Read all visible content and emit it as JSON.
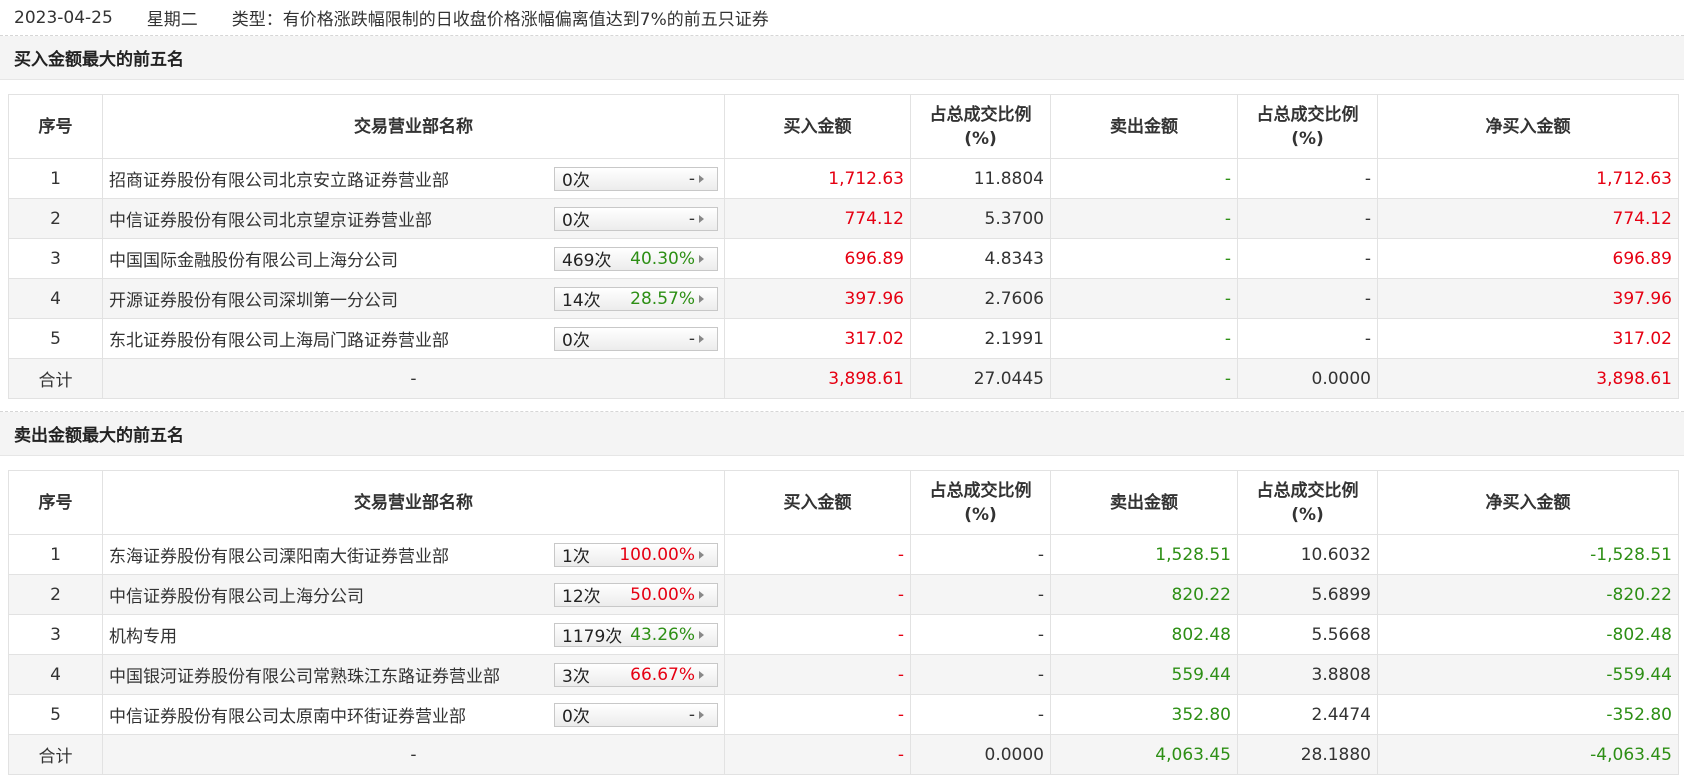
{
  "header": {
    "date": "2023-04-25",
    "weekday": "星期二",
    "type_text": "类型：有价格涨跌幅限制的日收盘价格涨幅偏离值达到7%的前五只证券"
  },
  "columns": {
    "idx": "序号",
    "name": "交易营业部名称",
    "buy": "买入金额",
    "ratio1_l1": "占总成交比例",
    "ratio1_l2": "(%)",
    "sell": "卖出金额",
    "ratio2_l1": "占总成交比例",
    "ratio2_l2": "(%)",
    "net": "净买入金额"
  },
  "buy_section": {
    "title": "买入金额最大的前五名",
    "rows": [
      {
        "idx": "1",
        "name": "招商证券股份有限公司北京安立路证券营业部",
        "count": "0次",
        "pct": "-",
        "pct_color": "dark",
        "buy": "1,712.63",
        "ratio1": "11.8804",
        "sell": "-",
        "ratio2": "-",
        "net": "1,712.63"
      },
      {
        "idx": "2",
        "name": "中信证券股份有限公司北京望京证券营业部",
        "count": "0次",
        "pct": "-",
        "pct_color": "dark",
        "buy": "774.12",
        "ratio1": "5.3700",
        "sell": "-",
        "ratio2": "-",
        "net": "774.12"
      },
      {
        "idx": "3",
        "name": "中国国际金融股份有限公司上海分公司",
        "count": "469次",
        "pct": "40.30%",
        "pct_color": "green",
        "buy": "696.89",
        "ratio1": "4.8343",
        "sell": "-",
        "ratio2": "-",
        "net": "696.89"
      },
      {
        "idx": "4",
        "name": "开源证券股份有限公司深圳第一分公司",
        "count": "14次",
        "pct": "28.57%",
        "pct_color": "green",
        "buy": "397.96",
        "ratio1": "2.7606",
        "sell": "-",
        "ratio2": "-",
        "net": "397.96"
      },
      {
        "idx": "5",
        "name": "东北证券股份有限公司上海局门路证券营业部",
        "count": "0次",
        "pct": "-",
        "pct_color": "dark",
        "buy": "317.02",
        "ratio1": "2.1991",
        "sell": "-",
        "ratio2": "-",
        "net": "317.02"
      }
    ],
    "total": {
      "label": "合计",
      "name": "-",
      "buy": "3,898.61",
      "ratio1": "27.0445",
      "sell": "-",
      "ratio2": "0.0000",
      "net": "3,898.61"
    }
  },
  "sell_section": {
    "title": "卖出金额最大的前五名",
    "rows": [
      {
        "idx": "1",
        "name": "东海证券股份有限公司溧阳南大街证券营业部",
        "count": "1次",
        "pct": "100.00%",
        "pct_color": "red",
        "buy": "-",
        "ratio1": "-",
        "sell": "1,528.51",
        "ratio2": "10.6032",
        "net": "-1,528.51"
      },
      {
        "idx": "2",
        "name": "中信证券股份有限公司上海分公司",
        "count": "12次",
        "pct": "50.00%",
        "pct_color": "red",
        "buy": "-",
        "ratio1": "-",
        "sell": "820.22",
        "ratio2": "5.6899",
        "net": "-820.22"
      },
      {
        "idx": "3",
        "name": "机构专用",
        "count": "1179次",
        "pct": "43.26%",
        "pct_color": "green",
        "buy": "-",
        "ratio1": "-",
        "sell": "802.48",
        "ratio2": "5.5668",
        "net": "-802.48"
      },
      {
        "idx": "4",
        "name": "中国银河证券股份有限公司常熟珠江东路证券营业部",
        "count": "3次",
        "pct": "66.67%",
        "pct_color": "red",
        "buy": "-",
        "ratio1": "-",
        "sell": "559.44",
        "ratio2": "3.8808",
        "net": "-559.44"
      },
      {
        "idx": "5",
        "name": "中信证券股份有限公司太原南中环街证券营业部",
        "count": "0次",
        "pct": "-",
        "pct_color": "dark",
        "buy": "-",
        "ratio1": "-",
        "sell": "352.80",
        "ratio2": "2.4474",
        "net": "-352.80"
      }
    ],
    "total": {
      "label": "合计",
      "name": "-",
      "buy": "-",
      "ratio1": "0.0000",
      "sell": "4,063.45",
      "ratio2": "28.1880",
      "net": "-4,063.45"
    }
  }
}
